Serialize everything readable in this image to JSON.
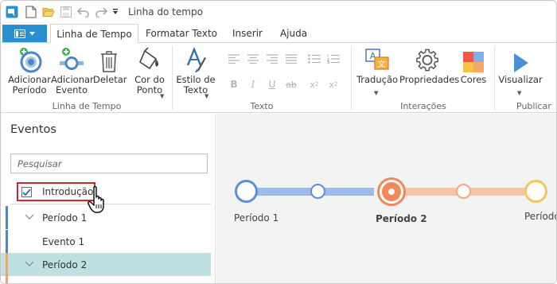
{
  "window": {
    "title": "Linha do tempo"
  },
  "quick_access": [
    "app-icon",
    "new-icon",
    "open-icon",
    "save-icon",
    "undo-icon",
    "redo-icon",
    "customize-icon"
  ],
  "ribbon": {
    "tabs": [
      {
        "label": "Linha de Tempo",
        "active": true
      },
      {
        "label": "Formatar Texto",
        "active": false
      },
      {
        "label": "Inserir",
        "active": false
      },
      {
        "label": "Ajuda",
        "active": false
      }
    ],
    "groups": {
      "timeline": {
        "label": "Linha de Tempo",
        "add_period": "Adicionar\nPeríodo",
        "add_event": "Adicionar\nEvento",
        "delete": "Deletar",
        "point_color": "Cor do\nPonto"
      },
      "text": {
        "label": "Texto",
        "text_style": "Estilo de\nTexto"
      },
      "interactions": {
        "label": "Interações",
        "translation": "Tradução",
        "properties": "Propriedades",
        "colors": "Cores"
      },
      "publish": {
        "label": "Publicar",
        "preview": "Visualizar"
      }
    }
  },
  "events_panel": {
    "title": "Eventos",
    "search_placeholder": "Pesquisar",
    "items": [
      {
        "label": "Introdução",
        "checked": true,
        "highlighted": true
      },
      {
        "label": "Período 1",
        "expanded": true,
        "color": "#4a86c8"
      },
      {
        "label": "Evento 1"
      },
      {
        "label": "Período 2",
        "expanded": true,
        "selected": true,
        "color": "#f0a46a"
      }
    ]
  },
  "timeline": {
    "labels": [
      "Período 1",
      "Período 2",
      "Período"
    ],
    "colors": {
      "period1": "#5b8fdc",
      "period2": "#f0885a",
      "period3": "#f3c85a"
    }
  },
  "colors": {
    "accent": "#2a8fcf",
    "selection": "#bfe0e0",
    "highlight_border": "#d0262d"
  }
}
